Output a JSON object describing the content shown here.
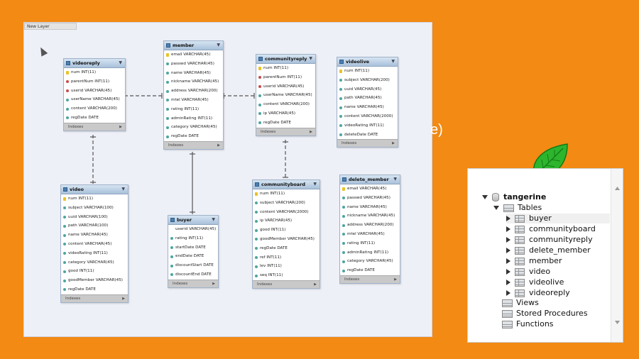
{
  "layer_label": "New Layer",
  "background_fragment": "e)",
  "colors": {
    "background": "#F28A14",
    "canvas": "#EEF0F8",
    "leaf": "#2DB52D"
  },
  "tables": [
    {
      "name": "videoreply",
      "columns": [
        {
          "text": "num INT(11)",
          "kind": "key"
        },
        {
          "text": "parentNum INT(11)",
          "kind": "fk"
        },
        {
          "text": "userid VARCHAR(45)",
          "kind": "fk"
        },
        {
          "text": "userName VARCHAR(45)",
          "kind": "nn"
        },
        {
          "text": "content VARCHAR(200)",
          "kind": "nn"
        },
        {
          "text": "regDate DATE",
          "kind": "nn"
        }
      ],
      "indexes": "Indexes"
    },
    {
      "name": "member",
      "columns": [
        {
          "text": "email VARCHAR(45)",
          "kind": "key"
        },
        {
          "text": "passwd VARCHAR(45)",
          "kind": "nn"
        },
        {
          "text": "name VARCHAR(45)",
          "kind": "nn"
        },
        {
          "text": "nickname VARCHAR(45)",
          "kind": "nn"
        },
        {
          "text": "address VARCHAR(200)",
          "kind": "nn"
        },
        {
          "text": "mtel VARCHAR(45)",
          "kind": "nn"
        },
        {
          "text": "rating INT(11)",
          "kind": "nn"
        },
        {
          "text": "adminRating INT(11)",
          "kind": "nn"
        },
        {
          "text": "category VARCHAR(45)",
          "kind": "nn"
        },
        {
          "text": "regDate DATE",
          "kind": "nn"
        }
      ],
      "indexes": "Indexes"
    },
    {
      "name": "communityreply",
      "columns": [
        {
          "text": "num INT(11)",
          "kind": "key"
        },
        {
          "text": "parentNum INT(11)",
          "kind": "fk"
        },
        {
          "text": "userid VARCHAR(45)",
          "kind": "fk"
        },
        {
          "text": "userName VARCHAR(45)",
          "kind": "nn"
        },
        {
          "text": "content VARCHAR(200)",
          "kind": "nn"
        },
        {
          "text": "ip VARCHAR(45)",
          "kind": "nn"
        },
        {
          "text": "regDate DATE",
          "kind": "nn"
        }
      ],
      "indexes": "Indexes"
    },
    {
      "name": "videolive",
      "columns": [
        {
          "text": "num INT(11)",
          "kind": "key"
        },
        {
          "text": "subject VARCHAR(200)",
          "kind": "nn"
        },
        {
          "text": "uuid VARCHAR(45)",
          "kind": "nn"
        },
        {
          "text": "path VARCHAR(45)",
          "kind": "nn"
        },
        {
          "text": "name VARCHAR(45)",
          "kind": "nn"
        },
        {
          "text": "content VARCHAR(2000)",
          "kind": "nn"
        },
        {
          "text": "videoRating INT(11)",
          "kind": "nn"
        },
        {
          "text": "deleteDate DATE",
          "kind": "nn"
        }
      ],
      "indexes": "Indexes"
    },
    {
      "name": "video",
      "columns": [
        {
          "text": "num INT(11)",
          "kind": "key"
        },
        {
          "text": "subject VARCHAR(100)",
          "kind": "nn"
        },
        {
          "text": "uuid VARCHAR(100)",
          "kind": "nn"
        },
        {
          "text": "path VARCHAR(100)",
          "kind": "nn"
        },
        {
          "text": "name VARCHAR(45)",
          "kind": "nn"
        },
        {
          "text": "content VARCHAR(45)",
          "kind": "nn"
        },
        {
          "text": "videoRating INT(11)",
          "kind": "nn"
        },
        {
          "text": "category VARCHAR(45)",
          "kind": "nn"
        },
        {
          "text": "good INT(11)",
          "kind": "nn"
        },
        {
          "text": "goodMember VARCHAR(45)",
          "kind": "nn"
        },
        {
          "text": "regDate DATE",
          "kind": "nn"
        }
      ],
      "indexes": "Indexes"
    },
    {
      "name": "buyer",
      "columns": [
        {
          "text": "userid VARCHAR(45)",
          "kind": "none"
        },
        {
          "text": "rating INT(11)",
          "kind": "nn"
        },
        {
          "text": "startDate DATE",
          "kind": "nn"
        },
        {
          "text": "endDate DATE",
          "kind": "nn"
        },
        {
          "text": "discountStart DATE",
          "kind": "nn"
        },
        {
          "text": "discountEnd DATE",
          "kind": "nn"
        }
      ],
      "indexes": "Indexes"
    },
    {
      "name": "communityboard",
      "columns": [
        {
          "text": "num INT(11)",
          "kind": "key"
        },
        {
          "text": "subject VARCHAR(200)",
          "kind": "nn"
        },
        {
          "text": "content VARCHAR(2000)",
          "kind": "nn"
        },
        {
          "text": "ip VARCHAR(45)",
          "kind": "nn"
        },
        {
          "text": "good INT(11)",
          "kind": "nn"
        },
        {
          "text": "goodMember VARCHAR(45)",
          "kind": "nn"
        },
        {
          "text": "regDate DATE",
          "kind": "nn"
        },
        {
          "text": "ref INT(11)",
          "kind": "nn"
        },
        {
          "text": "lev INT(11)",
          "kind": "nn"
        },
        {
          "text": "seq INT(11)",
          "kind": "nn"
        }
      ],
      "indexes": "Indexes"
    },
    {
      "name": "delete_member",
      "columns": [
        {
          "text": "email VARCHAR(45)",
          "kind": "key"
        },
        {
          "text": "passwd VARCHAR(45)",
          "kind": "nn"
        },
        {
          "text": "name VARCHAR(45)",
          "kind": "nn"
        },
        {
          "text": "nickname VARCHAR(45)",
          "kind": "nn"
        },
        {
          "text": "address VARCHAR(200)",
          "kind": "nn"
        },
        {
          "text": "mtel VARCHAR(45)",
          "kind": "nn"
        },
        {
          "text": "rating INT(11)",
          "kind": "nn"
        },
        {
          "text": "adminRating INT(11)",
          "kind": "nn"
        },
        {
          "text": "category VARCHAR(45)",
          "kind": "nn"
        },
        {
          "text": "regDate DATE",
          "kind": "nn"
        }
      ],
      "indexes": "Indexes"
    }
  ],
  "navigator": {
    "schema": "tangerine",
    "tables_label": "Tables",
    "tables": [
      "buyer",
      "communityboard",
      "communityreply",
      "delete_member",
      "member",
      "video",
      "videolive",
      "videoreply"
    ],
    "selected_table": "buyer",
    "other_nodes": [
      "Views",
      "Stored Procedures",
      "Functions"
    ]
  }
}
